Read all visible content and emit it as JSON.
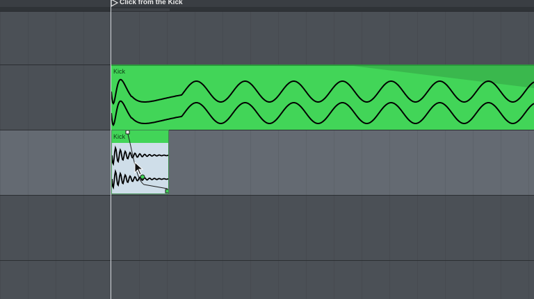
{
  "locator": {
    "label": "Click from the Kick"
  },
  "clips": {
    "main": {
      "name": "Kick",
      "color": "#42d558"
    },
    "small": {
      "name": "Kick",
      "color": "#42d558"
    }
  },
  "colors": {
    "track_bg": "#4b5056",
    "selected_track_bg": "#646a72",
    "waveform": "#000000",
    "playhead": "#d9dde2"
  },
  "icons": {
    "locator": "play-flag-icon",
    "cursor": "arrow-cursor-icon"
  }
}
